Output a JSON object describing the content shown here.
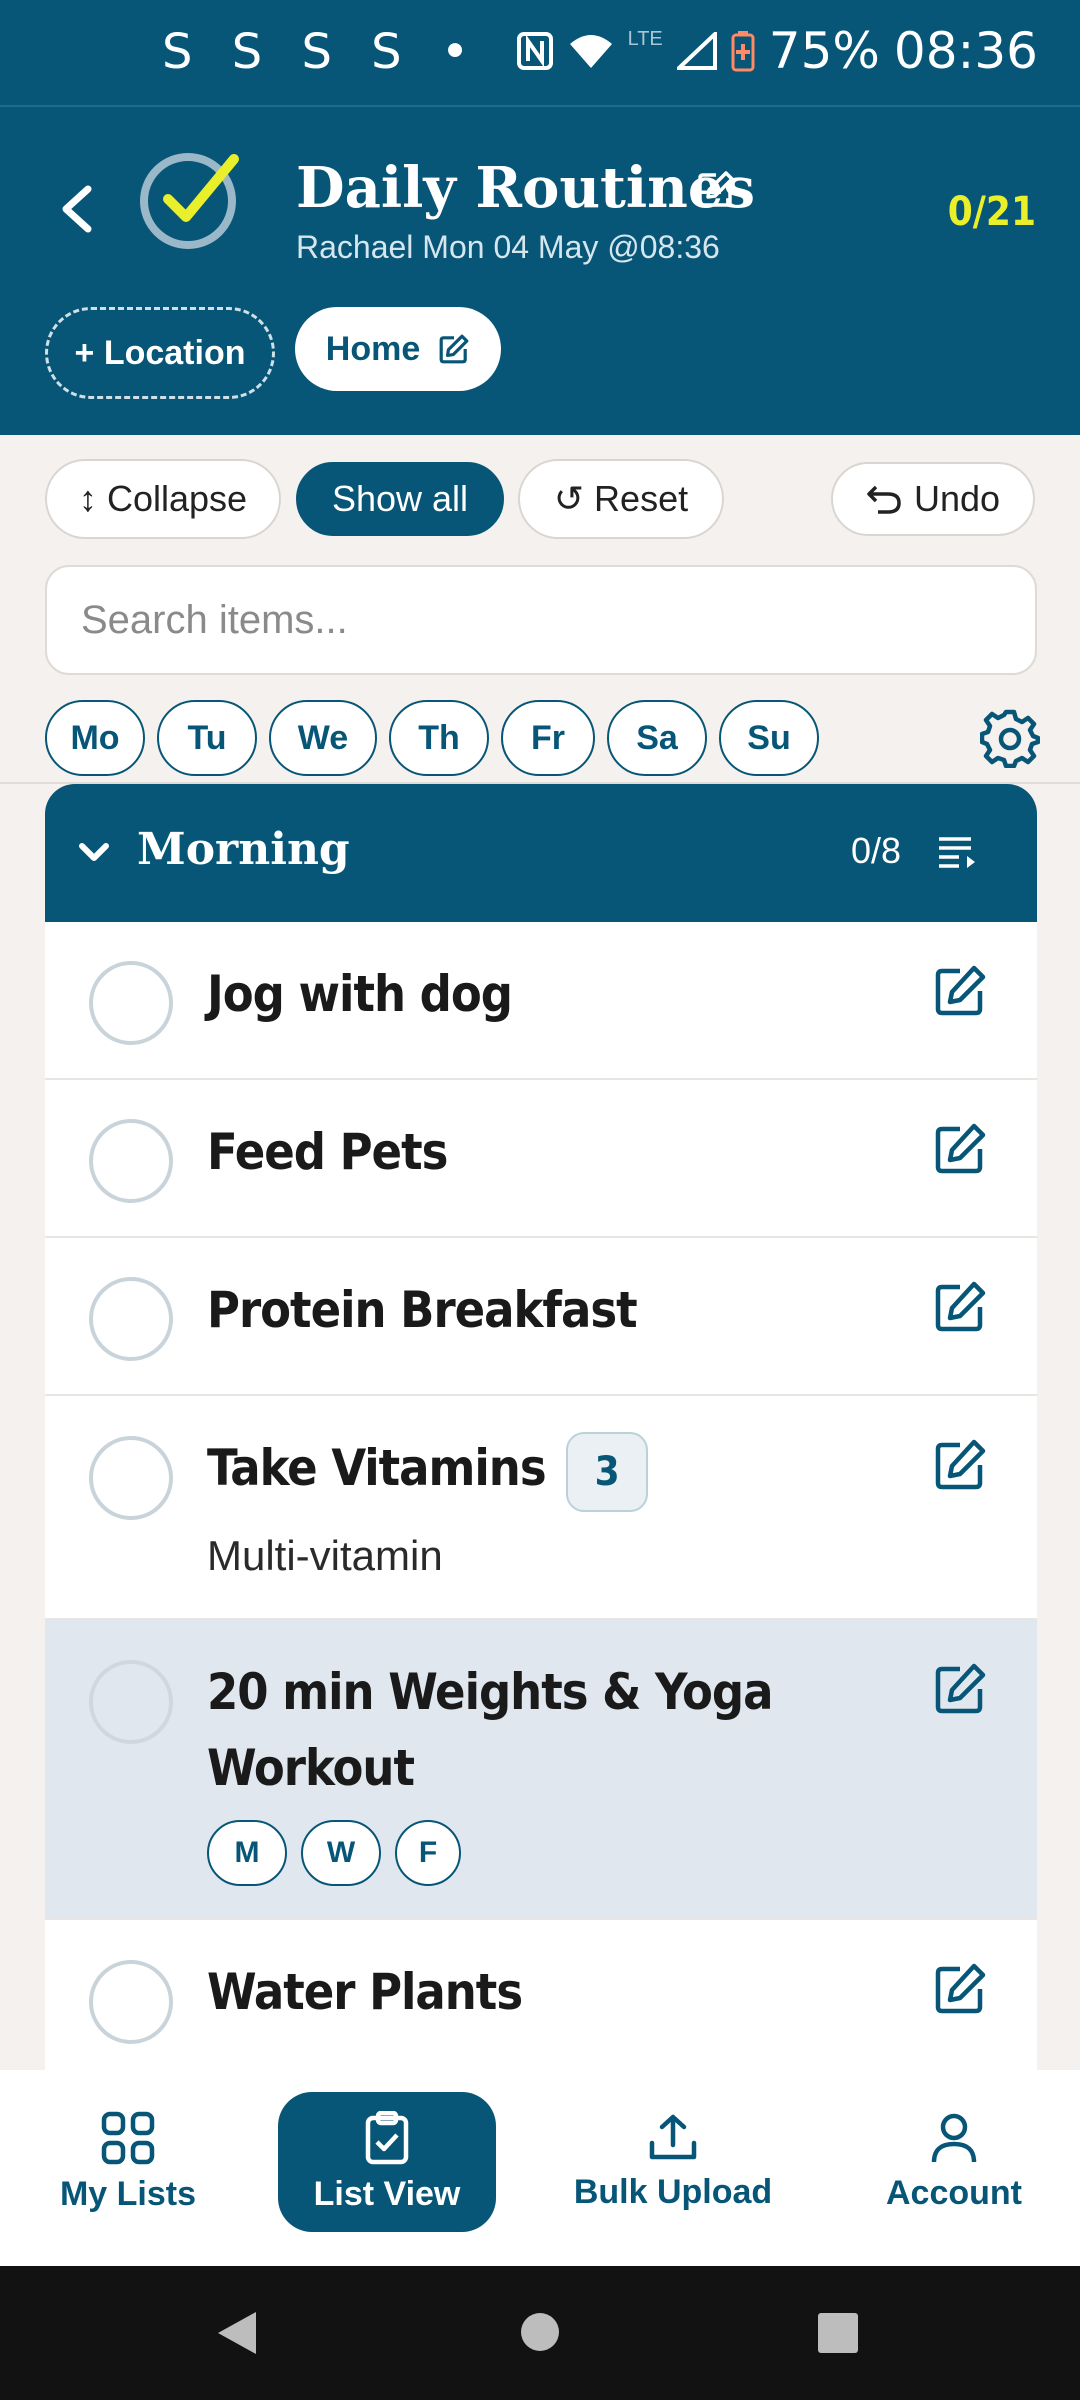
{
  "status_bar": {
    "notifications": "S S S S •",
    "lte_label": "LTE",
    "battery": "75%",
    "time": "08:36"
  },
  "header": {
    "title": "Daily Routines",
    "subtitle": "Rachael Mon 04 May @08:36",
    "progress": "0/21",
    "location_button": "+ Location",
    "home_button": "Home"
  },
  "toolbar": {
    "collapse": "↕ Collapse",
    "show_all": "Show all",
    "reset": "↺ Reset",
    "undo": "Undo"
  },
  "search": {
    "placeholder": "Search items..."
  },
  "days": [
    "Mo",
    "Tu",
    "We",
    "Th",
    "Fr",
    "Sa",
    "Su"
  ],
  "section": {
    "title": "Morning",
    "count": "0/8"
  },
  "items": [
    {
      "title": "Jog with dog"
    },
    {
      "title": "Feed Pets"
    },
    {
      "title": "Protein Breakfast"
    },
    {
      "title": "Take Vitamins",
      "qty": "3",
      "note": "Multi-vitamin"
    },
    {
      "title_line1": "20 min Weights & Yoga",
      "title_line2": "Workout",
      "days": [
        "M",
        "W",
        "F"
      ]
    },
    {
      "title": "Water Plants"
    }
  ],
  "bottom_nav": {
    "my_lists": "My Lists",
    "list_view": "List View",
    "bulk_upload": "Bulk Upload",
    "account": "Account"
  },
  "colors": {
    "primary": "#075677",
    "accent": "#e9ef2a",
    "highlight_row": "#e1e7ef",
    "background": "#f4f1ee"
  }
}
